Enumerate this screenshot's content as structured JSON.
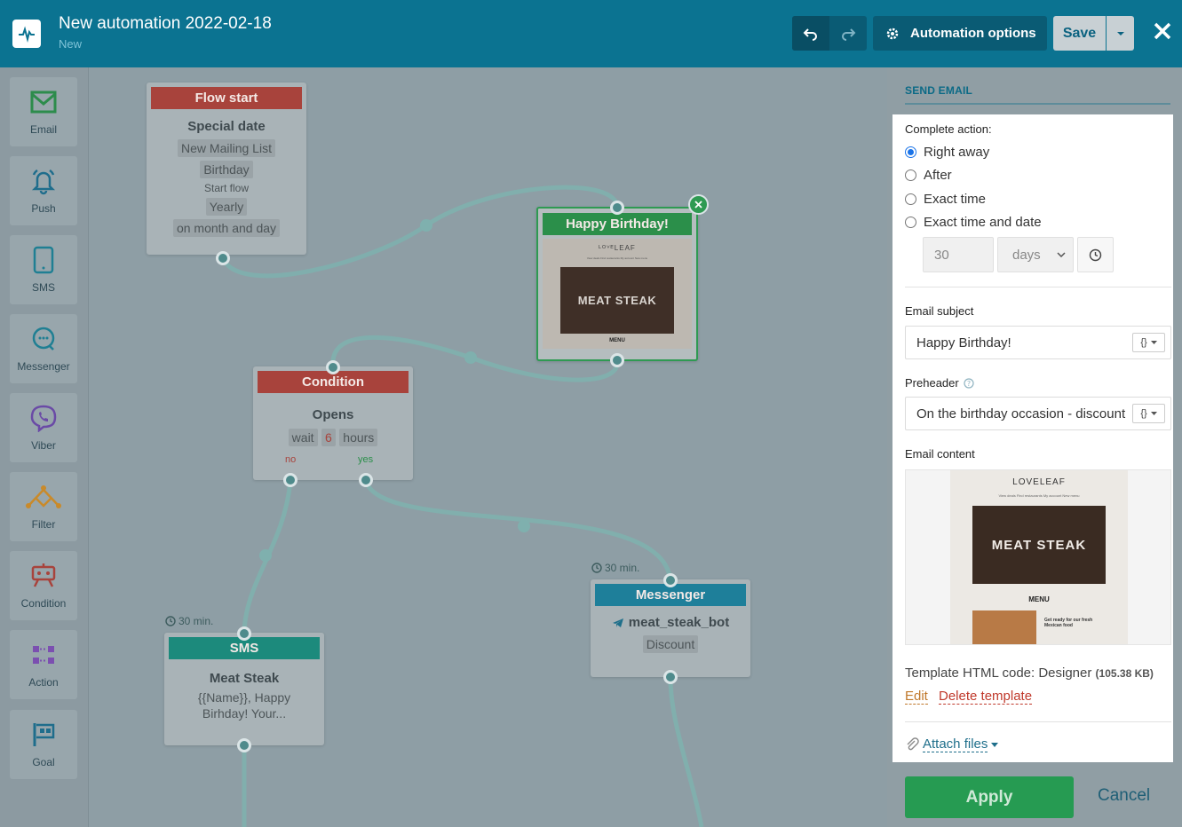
{
  "header": {
    "title": "New automation 2022-02-18",
    "subtitle": "New",
    "automation_options_label": "Automation options",
    "save_label": "Save"
  },
  "toolbar": {
    "items": [
      {
        "label": "Email",
        "icon": "envelope-icon"
      },
      {
        "label": "Push",
        "icon": "bell-icon"
      },
      {
        "label": "SMS",
        "icon": "phone-icon"
      },
      {
        "label": "Messenger",
        "icon": "chat-icon"
      },
      {
        "label": "Viber",
        "icon": "viber-icon"
      },
      {
        "label": "Filter",
        "icon": "filter-icon"
      },
      {
        "label": "Condition",
        "icon": "condition-icon"
      },
      {
        "label": "Action",
        "icon": "action-icon"
      },
      {
        "label": "Goal",
        "icon": "flag-icon"
      }
    ]
  },
  "canvas": {
    "flow_start": {
      "header": "Flow start",
      "title": "Special date",
      "list": "New Mailing List",
      "event": "Birthday",
      "start_flow": "Start flow",
      "frequency": "Yearly",
      "match": "on month and day"
    },
    "condition": {
      "header": "Condition",
      "title": "Opens",
      "wait": "wait",
      "amount": "6",
      "unit": "hours",
      "no": "no",
      "yes": "yes"
    },
    "birthday_email": {
      "header": "Happy Birthday!",
      "brand": "ᴸᴼⱽᴱLEAF",
      "nav": "View deals   Find restaurants   My account   New menu",
      "hero": "MEAT STEAK",
      "menu": "MENU"
    },
    "sms": {
      "timer": "30 min.",
      "header": "SMS",
      "title": "Meat Steak",
      "body": "{{Name}}, Happy Birhday! Your..."
    },
    "messenger": {
      "timer": "30 min.",
      "header": "Messenger",
      "bot": "meat_steak_bot",
      "chip": "Discount"
    }
  },
  "panel": {
    "title": "SEND EMAIL",
    "complete_action_label": "Complete action:",
    "options": [
      "Right away",
      "After",
      "Exact time",
      "Exact time and date"
    ],
    "selected_option": "Right away",
    "delay_value": "30",
    "delay_unit": "days",
    "subject_label": "Email subject",
    "subject_value": "Happy Birthday!",
    "preheader_label": "Preheader",
    "preheader_value": "On the birthday occasion - discount",
    "content_label": "Email content",
    "preview": {
      "brand": "LOVELEAF",
      "nav": "View deals   Find restaurants   My account   New menu",
      "hero": "MEAT STEAK",
      "menu": "MENU",
      "food_text": "Get ready for our fresh Mexican food"
    },
    "template_label": "Template HTML code: Designer",
    "template_size": "(105.38 KB)",
    "edit_label": "Edit",
    "delete_label": "Delete template",
    "attach_label": "Attach files",
    "apply_label": "Apply",
    "cancel_label": "Cancel"
  },
  "colors": {
    "header": "#0b7391",
    "apply": "#269b52",
    "link_red": "#c0392b",
    "link_blue": "#1f6f8b"
  }
}
